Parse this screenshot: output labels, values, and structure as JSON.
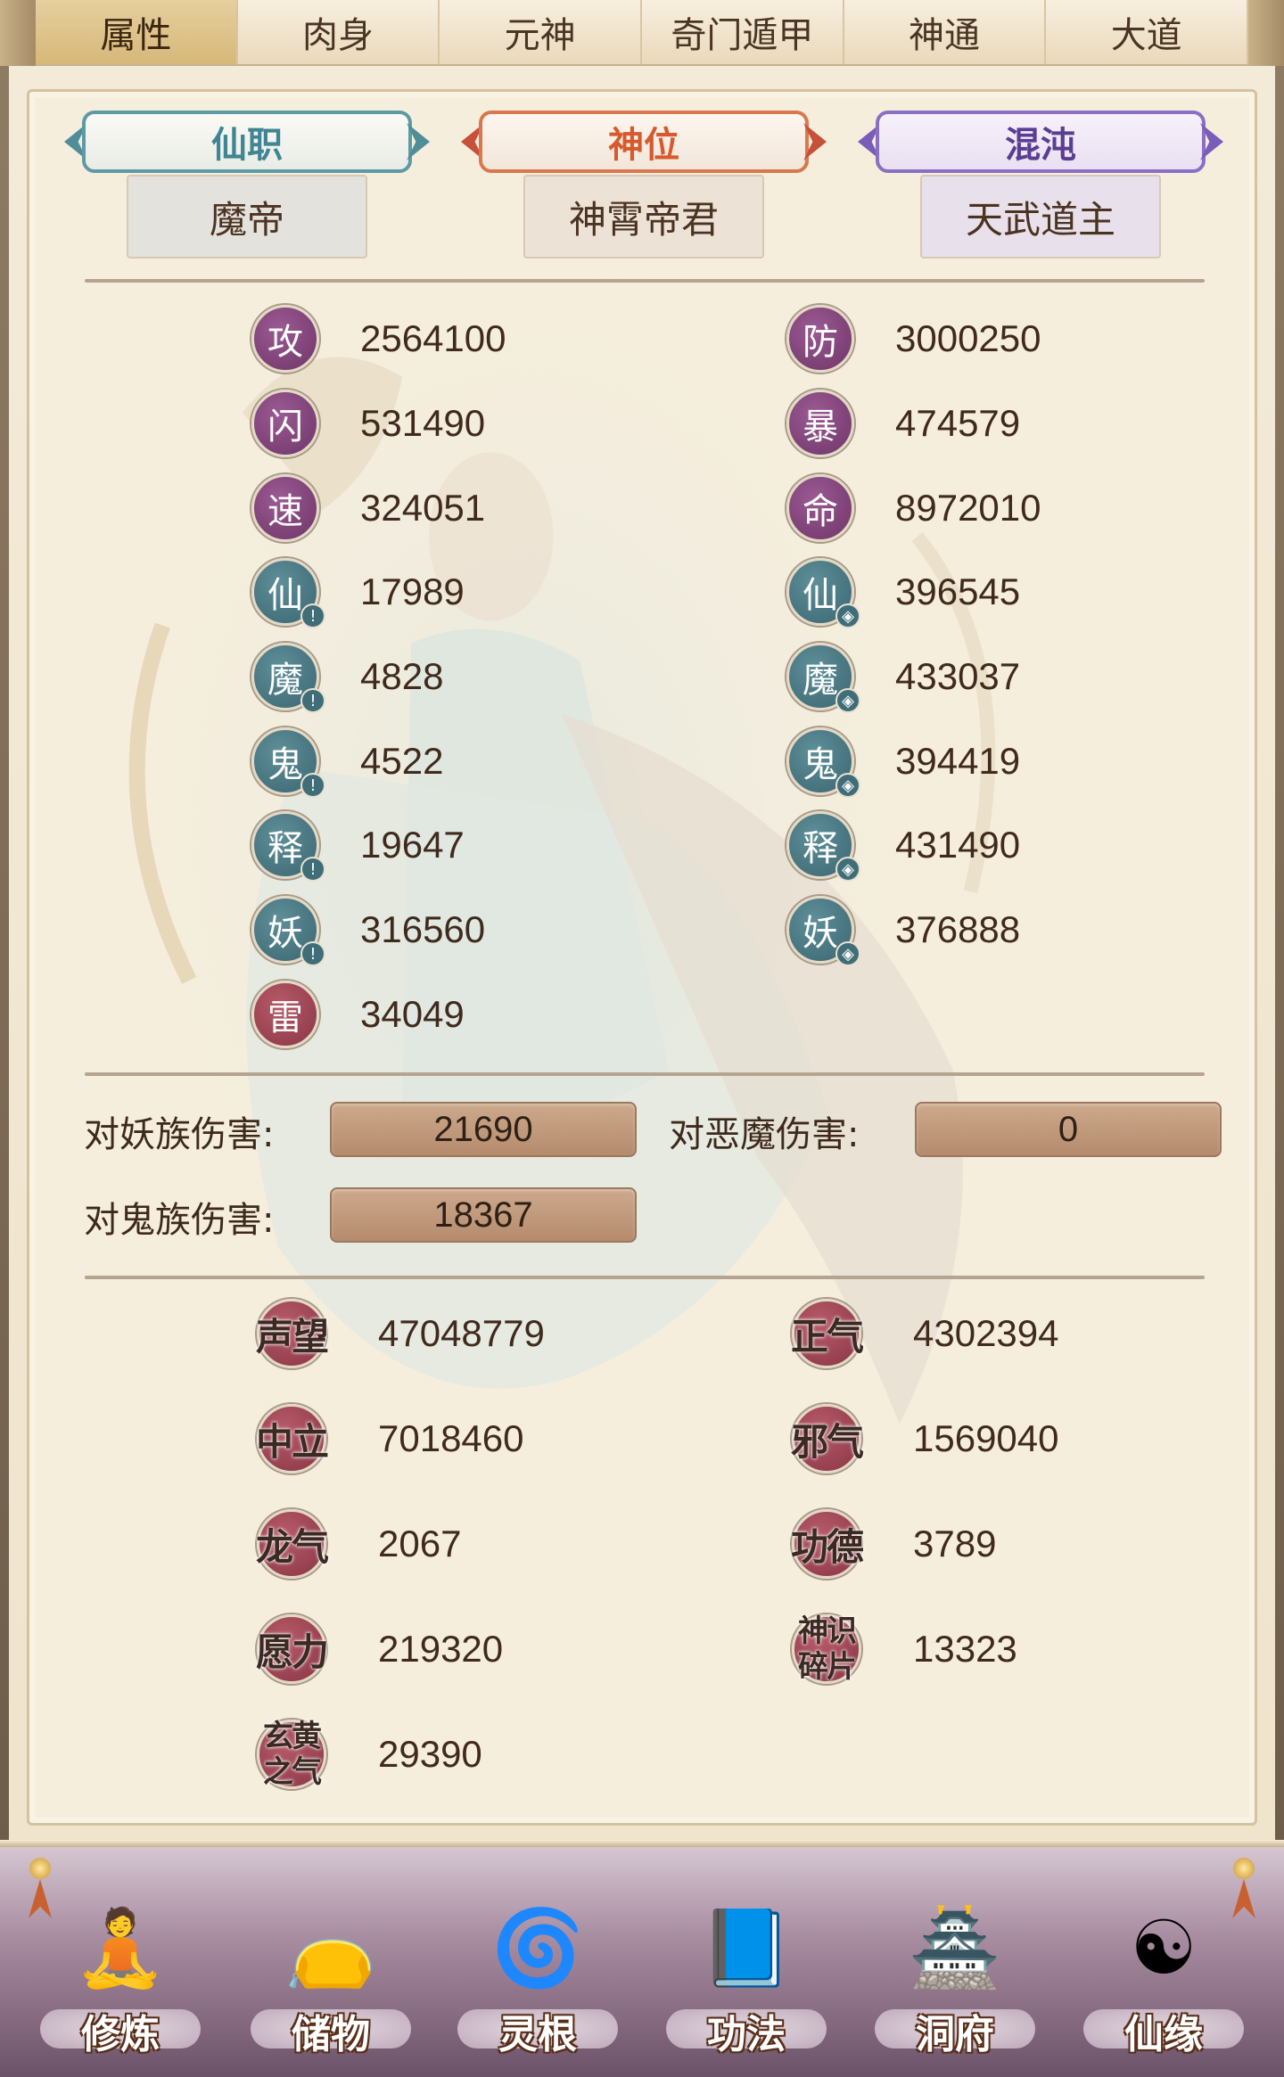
{
  "tabs": [
    {
      "label": "属性",
      "active": true
    },
    {
      "label": "肉身",
      "active": false
    },
    {
      "label": "元神",
      "active": false
    },
    {
      "label": "奇门遁甲",
      "active": false
    },
    {
      "label": "神通",
      "active": false
    },
    {
      "label": "大道",
      "active": false
    }
  ],
  "titles": [
    {
      "banner": "仙职",
      "value": "魔帝",
      "color": "#3f8593"
    },
    {
      "banner": "神位",
      "value": "神霄帝君",
      "color": "#d65a2d"
    },
    {
      "banner": "混沌",
      "value": "天武道主",
      "color": "#5a3e92"
    }
  ],
  "stats_left": [
    {
      "icon": "攻",
      "value": "2564100",
      "style": "purple",
      "badge": ""
    },
    {
      "icon": "闪",
      "value": "531490",
      "style": "purple",
      "badge": ""
    },
    {
      "icon": "速",
      "value": "324051",
      "style": "purple",
      "badge": ""
    },
    {
      "icon": "仙",
      "value": "17989",
      "style": "teal",
      "badge": "attack"
    },
    {
      "icon": "魔",
      "value": "4828",
      "style": "teal",
      "badge": "attack"
    },
    {
      "icon": "鬼",
      "value": "4522",
      "style": "teal",
      "badge": "attack"
    },
    {
      "icon": "释",
      "value": "19647",
      "style": "teal",
      "badge": "attack"
    },
    {
      "icon": "妖",
      "value": "316560",
      "style": "teal",
      "badge": "attack"
    },
    {
      "icon": "雷",
      "value": "34049",
      "style": "red",
      "badge": ""
    }
  ],
  "stats_right": [
    {
      "icon": "防",
      "value": "3000250",
      "style": "purple",
      "badge": ""
    },
    {
      "icon": "暴",
      "value": "474579",
      "style": "purple",
      "badge": ""
    },
    {
      "icon": "命",
      "value": "8972010",
      "style": "purple",
      "badge": ""
    },
    {
      "icon": "仙",
      "value": "396545",
      "style": "teal",
      "badge": "shield"
    },
    {
      "icon": "魔",
      "value": "433037",
      "style": "teal",
      "badge": "shield"
    },
    {
      "icon": "鬼",
      "value": "394419",
      "style": "teal",
      "badge": "shield"
    },
    {
      "icon": "释",
      "value": "431490",
      "style": "teal",
      "badge": "shield"
    },
    {
      "icon": "妖",
      "value": "376888",
      "style": "teal",
      "badge": "shield"
    }
  ],
  "damage": {
    "vs_demon_race_label": "对妖族伤害:",
    "vs_demon_race_value": "21690",
    "vs_evil_label": "对恶魔伤害:",
    "vs_evil_value": "0",
    "vs_ghost_label": "对鬼族伤害:",
    "vs_ghost_value": "18367"
  },
  "repute_left": [
    {
      "label": "声望",
      "value": "47048779"
    },
    {
      "label": "中立",
      "value": "7018460"
    },
    {
      "label": "龙气",
      "value": "2067"
    },
    {
      "label": "愿力",
      "value": "219320"
    },
    {
      "label": "玄黄之气",
      "value": "29390"
    }
  ],
  "repute_right": [
    {
      "label": "正气",
      "value": "4302394"
    },
    {
      "label": "邪气",
      "value": "1569040"
    },
    {
      "label": "功德",
      "value": "3789"
    },
    {
      "label": "神识碎片",
      "value": "13323"
    }
  ],
  "bottom_nav": [
    {
      "label": "修炼",
      "icon": "meditating-monk-icon",
      "glyph": "🧘"
    },
    {
      "label": "储物",
      "icon": "treasure-bag-icon",
      "glyph": "👝"
    },
    {
      "label": "灵根",
      "icon": "spirit-root-orb-icon",
      "glyph": "🌀"
    },
    {
      "label": "功法",
      "icon": "scripture-book-icon",
      "glyph": "📘"
    },
    {
      "label": "洞府",
      "icon": "cave-palace-icon",
      "glyph": "🏯"
    },
    {
      "label": "仙缘",
      "icon": "gourd-icon",
      "glyph": "☯"
    }
  ]
}
